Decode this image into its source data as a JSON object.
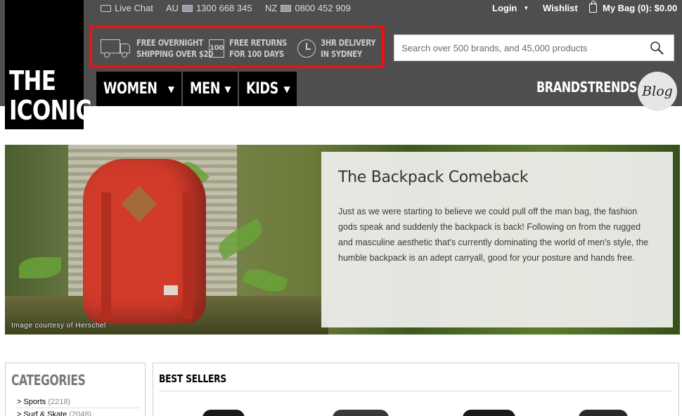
{
  "brand": {
    "line1": "THE",
    "line2": "ICONIC"
  },
  "topbar": {
    "live_chat": "Live Chat",
    "au_label": "AU",
    "au_phone": "1300 668 345",
    "nz_label": "NZ",
    "nz_phone": "0800 452 909",
    "login": "Login",
    "wishlist": "Wishlist",
    "bag": "My Bag (0): $0.00"
  },
  "promos": [
    {
      "line1": "FREE OVERNIGHT",
      "line2": "SHIPPING OVER $20",
      "icon": "truck-icon"
    },
    {
      "line1": "FREE RETURNS",
      "line2": "FOR 100 DAYS",
      "icon": "returns-icon",
      "icon_text": "100"
    },
    {
      "line1": "3HR DELIVERY",
      "line2": "IN SYDNEY",
      "icon": "clock-icon"
    }
  ],
  "search": {
    "placeholder": "Search over 500 brands, and 45,000 products",
    "value": ""
  },
  "nav": {
    "women": "WOMEN",
    "men": "MEN",
    "kids": "KIDS",
    "brands": "BRANDS",
    "trends": "TRENDS",
    "blog": "Blog",
    "caret": "▼"
  },
  "hero": {
    "title": "The Backpack Comeback",
    "body": "Just as we were starting to believe we could pull off the man bag, the fashion gods speak and suddenly the backpack is back! Following on from the rugged and masculine aesthetic that's currently dominating the world of men's style, the humble backpack is an adept carryall, good for your posture and hands free.",
    "credit": "Image courtesy of Herschel"
  },
  "categories": {
    "title": "CATEGORIES",
    "items": [
      {
        "prefix": "> ",
        "label": "Sports",
        "count": "(2218)"
      },
      {
        "prefix": "> ",
        "label": "Surf & Skate",
        "count": "(2048)"
      }
    ]
  },
  "best_sellers": {
    "title": "BEST SELLERS"
  },
  "colors": {
    "header_bg": "#4e4e4e",
    "promo_border": "#ee1010",
    "nav_bg": "#000000"
  }
}
